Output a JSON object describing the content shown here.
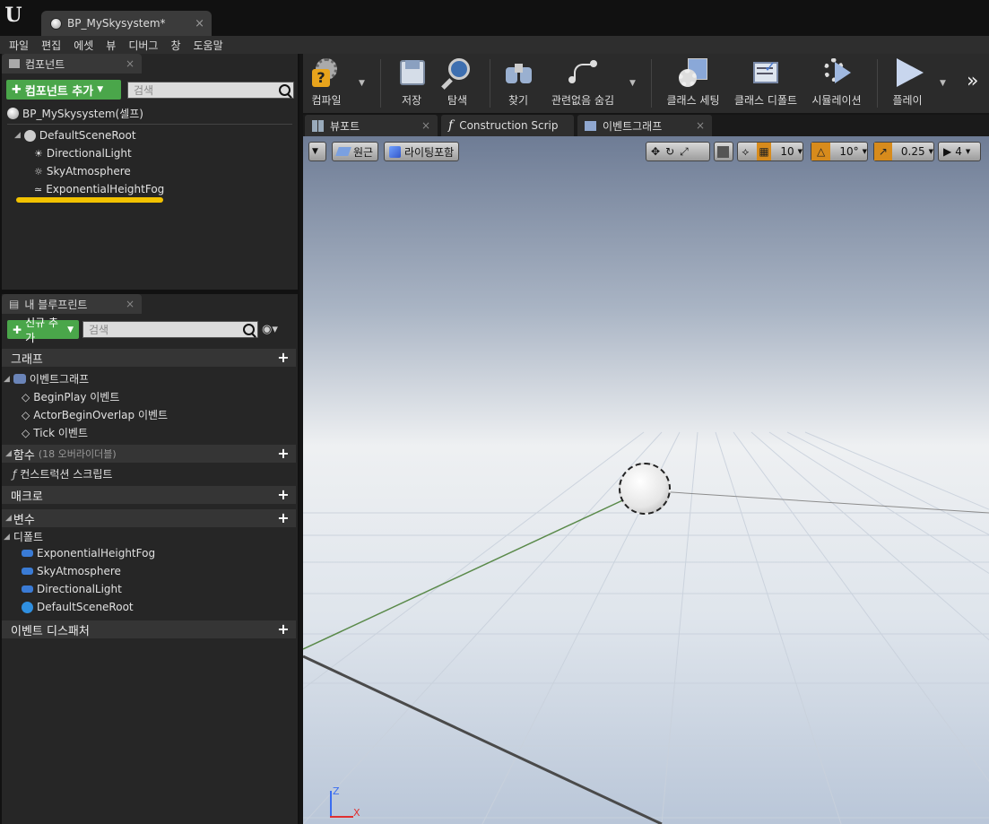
{
  "titlebar": {
    "logo": "U",
    "document_tab": "BP_MySkysystem*",
    "close": "×"
  },
  "menu": [
    "파일",
    "편집",
    "에셋",
    "뷰",
    "디버그",
    "창",
    "도움말"
  ],
  "components_panel": {
    "tab_label": "컴포넌트",
    "close": "×",
    "add_button": "컴포넌트 추가",
    "search_placeholder": "검색",
    "self_item": "BP_MySkysystem(셀프)",
    "tree": [
      {
        "label": "DefaultSceneRoot",
        "icon": "scene-root-icon"
      },
      {
        "label": "DirectionalLight",
        "icon": "directional-light-icon"
      },
      {
        "label": "SkyAtmosphere",
        "icon": "sky-atmosphere-icon"
      },
      {
        "label": "ExponentialHeightFog",
        "icon": "height-fog-icon"
      }
    ],
    "highlight_color": "#f2c200"
  },
  "blueprint_panel": {
    "tab_label": "내 블루프린트",
    "close": "×",
    "add_button": "신규 추가",
    "search_placeholder": "검색",
    "sections": {
      "graph": "그래프",
      "event_graph": "이벤트그래프",
      "events": [
        "BeginPlay 이벤트",
        "ActorBeginOverlap 이벤트",
        "Tick 이벤트"
      ],
      "functions": "함수",
      "functions_sub": "(18 오버라이더블)",
      "construction_script": "컨스트럭션 스크립트",
      "macros": "매크로",
      "variables": "변수",
      "components_group": "디폴트",
      "component_vars": [
        "ExponentialHeightFog",
        "SkyAtmosphere",
        "DirectionalLight",
        "DefaultSceneRoot"
      ],
      "dispatchers": "이벤트 디스패처"
    }
  },
  "toolbar": {
    "compile": "컴파일",
    "save": "저장",
    "browse": "탐색",
    "find": "찾기",
    "hide_unrelated": "관련없음 숨김",
    "class_settings": "클래스 세팅",
    "class_defaults": "클래스 디폴트",
    "simulation": "시뮬레이션",
    "play": "플레이",
    "more": "»"
  },
  "view_tabs": {
    "viewport": "뷰포트",
    "construction": "Construction Scrip",
    "event_graph": "이벤트그래프",
    "close": "×"
  },
  "viewport": {
    "perspective": "원근",
    "lit": "라이팅포함",
    "grid_snap": "10",
    "rotation_snap": "10°",
    "scale_snap": "0.25",
    "camera_speed": "4",
    "axis_x": "X",
    "axis_z": "Z"
  }
}
